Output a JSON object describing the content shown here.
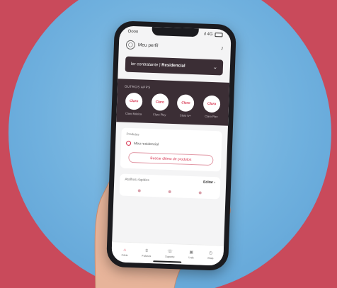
{
  "status_bar": {
    "time": "Oooo",
    "signal": "ıl 4G"
  },
  "profile": {
    "label": "Meu perfil"
  },
  "service_selector": {
    "prefix": "ler contratante",
    "value": "Residencial"
  },
  "apps_section": {
    "title": "OUTROS APPS",
    "apps": [
      {
        "logo": "Claro",
        "label": "Claro Música"
      },
      {
        "logo": "Claro",
        "label": "Claro Play"
      },
      {
        "logo": "Claro",
        "label": "Claro tv+"
      },
      {
        "logo": "Claro",
        "label": "Claro Flex"
      }
    ]
  },
  "products_card": {
    "title": "Produtos",
    "item": "Meu residencial",
    "button": "Buscar último de produtos"
  },
  "shortcuts_card": {
    "title": "Atalhos rápidos",
    "action": "Editar"
  },
  "tabbar": {
    "tabs": [
      {
        "label": "Início",
        "icon": "home-icon"
      },
      {
        "label": "Faturas",
        "icon": "invoice-icon"
      },
      {
        "label": "Suporte",
        "icon": "support-icon"
      },
      {
        "label": "Loja",
        "icon": "store-icon"
      },
      {
        "label": "Mais",
        "icon": "more-icon"
      }
    ]
  },
  "colors": {
    "accent": "#d62d4a",
    "dark": "#3b2e35",
    "background": "#c94a5b",
    "circle": "#6fb0de"
  }
}
